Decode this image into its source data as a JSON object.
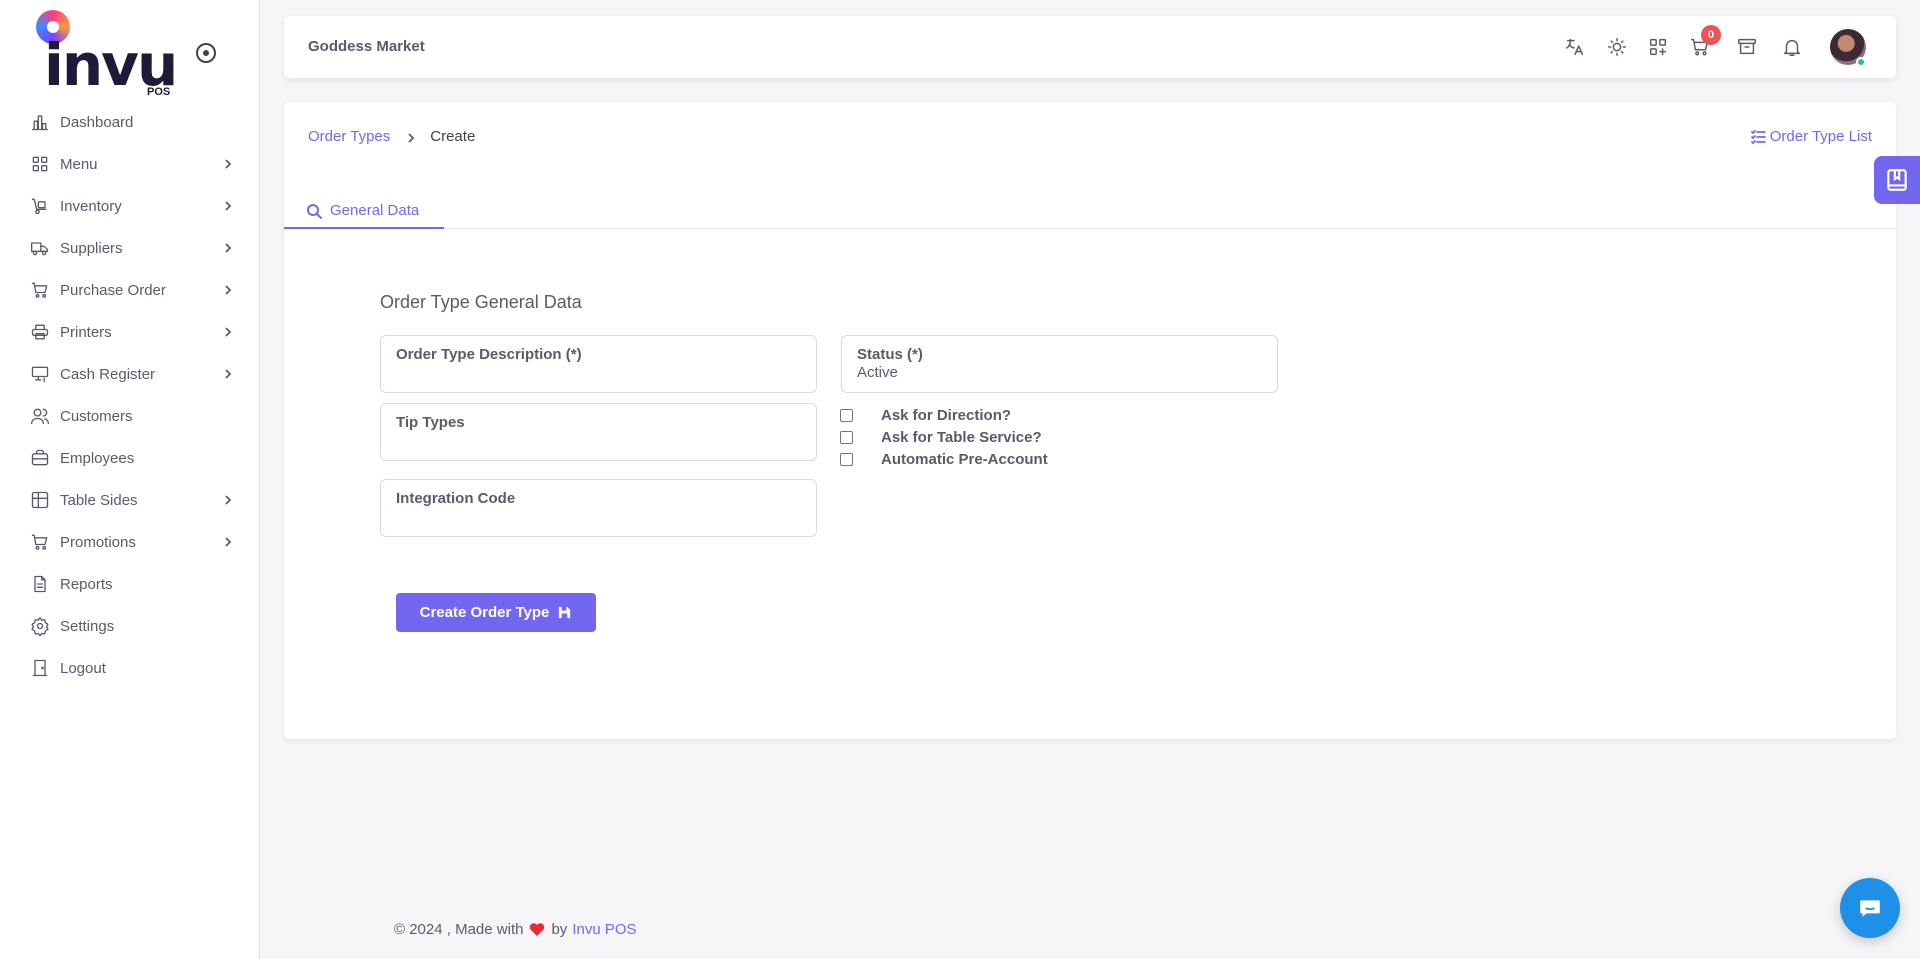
{
  "brand": {
    "logo_text": "invu",
    "logo_sub": "POS"
  },
  "sidebar": {
    "items": [
      {
        "label": "Dashboard",
        "icon": "chart-bar-icon",
        "has_submenu": false
      },
      {
        "label": "Menu",
        "icon": "grid-icon",
        "has_submenu": true
      },
      {
        "label": "Inventory",
        "icon": "dolly-icon",
        "has_submenu": true
      },
      {
        "label": "Suppliers",
        "icon": "truck-icon",
        "has_submenu": true
      },
      {
        "label": "Purchase Order",
        "icon": "cart-icon",
        "has_submenu": true
      },
      {
        "label": "Printers",
        "icon": "printer-icon",
        "has_submenu": true
      },
      {
        "label": "Cash Register",
        "icon": "register-icon",
        "has_submenu": true
      },
      {
        "label": "Customers",
        "icon": "users-icon",
        "has_submenu": false
      },
      {
        "label": "Employees",
        "icon": "briefcase-icon",
        "has_submenu": false
      },
      {
        "label": "Table Sides",
        "icon": "table-icon",
        "has_submenu": true
      },
      {
        "label": "Promotions",
        "icon": "cart-icon",
        "has_submenu": true
      },
      {
        "label": "Reports",
        "icon": "file-icon",
        "has_submenu": false
      },
      {
        "label": "Settings",
        "icon": "gear-icon",
        "has_submenu": false
      },
      {
        "label": "Logout",
        "icon": "door-icon",
        "has_submenu": false
      }
    ]
  },
  "topbar": {
    "shop_name": "Goddess Market",
    "cart_count": "0",
    "icons": [
      "translate-icon",
      "sun-icon",
      "apps-icon",
      "cart-icon",
      "archive-icon",
      "bell-icon"
    ]
  },
  "breadcrumb": {
    "parent": "Order Types",
    "current": "Create"
  },
  "list_link": "Order Type List",
  "tabs": [
    {
      "label": "General Data",
      "active": true
    }
  ],
  "form": {
    "section_title": "Order Type General Data",
    "description_label": "Order Type Description (*)",
    "description_value": "",
    "status_label": "Status (*)",
    "status_value": "Active",
    "tip_types_label": "Tip Types",
    "tip_types_value": "",
    "integration_label": "Integration Code",
    "integration_value": "",
    "checkboxes": [
      {
        "label": "Ask for Direction?",
        "checked": false
      },
      {
        "label": "Ask for Table Service?",
        "checked": false
      },
      {
        "label": "Automatic Pre-Account",
        "checked": false
      }
    ],
    "submit_label": "Create Order Type"
  },
  "footer": {
    "prefix": "© 2024 , Made with",
    "by": "by",
    "link": "Invu POS"
  },
  "colors": {
    "primary": "#7367f0",
    "badge": "#ea5455",
    "chat": "#1e90e8",
    "online": "#28c76f"
  }
}
